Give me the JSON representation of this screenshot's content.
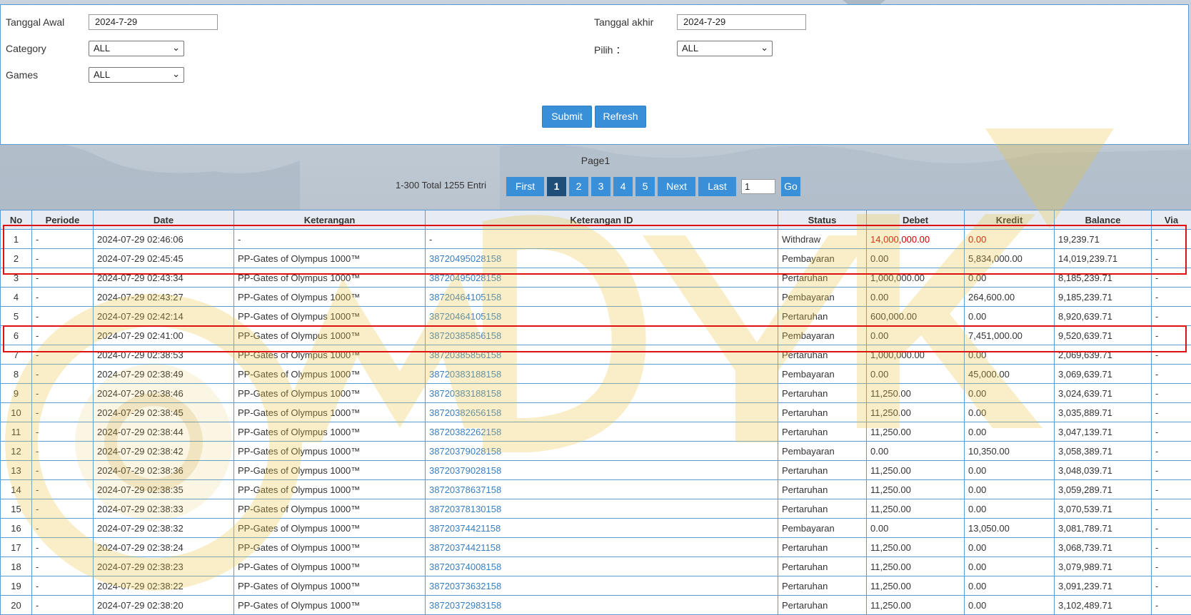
{
  "filters": {
    "tanggal_awal_label": "Tanggal Awal",
    "tanggal_awal_value": "2024-7-29",
    "tanggal_akhir_label": "Tanggal akhir",
    "tanggal_akhir_value": "2024-7-29",
    "category_label": "Category",
    "category_value": "ALL",
    "pilih_label": "Pilih ：",
    "pilih_value": "ALL",
    "games_label": "Games",
    "games_value": "ALL",
    "submit_label": "Submit",
    "refresh_label": "Refresh"
  },
  "pager": {
    "title": "Page1",
    "info": "1-300 Total 1255 Entri",
    "first_label": "First",
    "pages": [
      "1",
      "2",
      "3",
      "4",
      "5"
    ],
    "active_page": "1",
    "next_label": "Next",
    "last_label": "Last",
    "goto_value": "1",
    "go_label": "Go"
  },
  "table": {
    "headers": [
      "No",
      "Periode",
      "Date",
      "Keterangan",
      "Keterangan ID",
      "Status",
      "Debet",
      "Kredit",
      "Balance",
      "Via"
    ],
    "rows": [
      [
        "1",
        "-",
        "2024-07-29 02:46:06",
        "-",
        "-",
        "Withdraw",
        "14,000,000.00",
        "0.00",
        "19,239.71",
        "-"
      ],
      [
        "2",
        "-",
        "2024-07-29 02:45:45",
        "PP-Gates of Olympus 1000™",
        "38720495028158",
        "Pembayaran",
        "0.00",
        "5,834,000.00",
        "14,019,239.71",
        "-"
      ],
      [
        "3",
        "-",
        "2024-07-29 02:43:34",
        "PP-Gates of Olympus 1000™",
        "38720495028158",
        "Pertaruhan",
        "1,000,000.00",
        "0.00",
        "8,185,239.71",
        "-"
      ],
      [
        "4",
        "-",
        "2024-07-29 02:43:27",
        "PP-Gates of Olympus 1000™",
        "38720464105158",
        "Pembayaran",
        "0.00",
        "264,600.00",
        "9,185,239.71",
        "-"
      ],
      [
        "5",
        "-",
        "2024-07-29 02:42:14",
        "PP-Gates of Olympus 1000™",
        "38720464105158",
        "Pertaruhan",
        "600,000.00",
        "0.00",
        "8,920,639.71",
        "-"
      ],
      [
        "6",
        "-",
        "2024-07-29 02:41:00",
        "PP-Gates of Olympus 1000™",
        "38720385856158",
        "Pembayaran",
        "0.00",
        "7,451,000.00",
        "9,520,639.71",
        "-"
      ],
      [
        "7",
        "-",
        "2024-07-29 02:38:53",
        "PP-Gates of Olympus 1000™",
        "38720385856158",
        "Pertaruhan",
        "1,000,000.00",
        "0.00",
        "2,069,639.71",
        "-"
      ],
      [
        "8",
        "-",
        "2024-07-29 02:38:49",
        "PP-Gates of Olympus 1000™",
        "38720383188158",
        "Pembayaran",
        "0.00",
        "45,000.00",
        "3,069,639.71",
        "-"
      ],
      [
        "9",
        "-",
        "2024-07-29 02:38:46",
        "PP-Gates of Olympus 1000™",
        "38720383188158",
        "Pertaruhan",
        "11,250.00",
        "0.00",
        "3,024,639.71",
        "-"
      ],
      [
        "10",
        "-",
        "2024-07-29 02:38:45",
        "PP-Gates of Olympus 1000™",
        "38720382656158",
        "Pertaruhan",
        "11,250.00",
        "0.00",
        "3,035,889.71",
        "-"
      ],
      [
        "11",
        "-",
        "2024-07-29 02:38:44",
        "PP-Gates of Olympus 1000™",
        "38720382262158",
        "Pertaruhan",
        "11,250.00",
        "0.00",
        "3,047,139.71",
        "-"
      ],
      [
        "12",
        "-",
        "2024-07-29 02:38:42",
        "PP-Gates of Olympus 1000™",
        "38720379028158",
        "Pembayaran",
        "0.00",
        "10,350.00",
        "3,058,389.71",
        "-"
      ],
      [
        "13",
        "-",
        "2024-07-29 02:38:36",
        "PP-Gates of Olympus 1000™",
        "38720379028158",
        "Pertaruhan",
        "11,250.00",
        "0.00",
        "3,048,039.71",
        "-"
      ],
      [
        "14",
        "-",
        "2024-07-29 02:38:35",
        "PP-Gates of Olympus 1000™",
        "38720378637158",
        "Pertaruhan",
        "11,250.00",
        "0.00",
        "3,059,289.71",
        "-"
      ],
      [
        "15",
        "-",
        "2024-07-29 02:38:33",
        "PP-Gates of Olympus 1000™",
        "38720378130158",
        "Pertaruhan",
        "11,250.00",
        "0.00",
        "3,070,539.71",
        "-"
      ],
      [
        "16",
        "-",
        "2024-07-29 02:38:32",
        "PP-Gates of Olympus 1000™",
        "38720374421158",
        "Pembayaran",
        "0.00",
        "13,050.00",
        "3,081,789.71",
        "-"
      ],
      [
        "17",
        "-",
        "2024-07-29 02:38:24",
        "PP-Gates of Olympus 1000™",
        "38720374421158",
        "Pertaruhan",
        "11,250.00",
        "0.00",
        "3,068,739.71",
        "-"
      ],
      [
        "18",
        "-",
        "2024-07-29 02:38:23",
        "PP-Gates of Olympus 1000™",
        "38720374008158",
        "Pertaruhan",
        "11,250.00",
        "0.00",
        "3,079,989.71",
        "-"
      ],
      [
        "19",
        "-",
        "2024-07-29 02:38:22",
        "PP-Gates of Olympus 1000™",
        "38720373632158",
        "Pertaruhan",
        "11,250.00",
        "0.00",
        "3,091,239.71",
        "-"
      ],
      [
        "20",
        "-",
        "2024-07-29 02:38:20",
        "PP-Gates of Olympus 1000™",
        "38720372983158",
        "Pertaruhan",
        "11,250.00",
        "0.00",
        "3,102,489.71",
        "-"
      ]
    ]
  },
  "colors": {
    "accent": "#3a8fd9",
    "active_page": "#1f4e79",
    "link": "#3a7fc1",
    "negative": "#cc0000",
    "highlight_box": "#dd1111",
    "watermark_gold": "#e8c23a"
  }
}
